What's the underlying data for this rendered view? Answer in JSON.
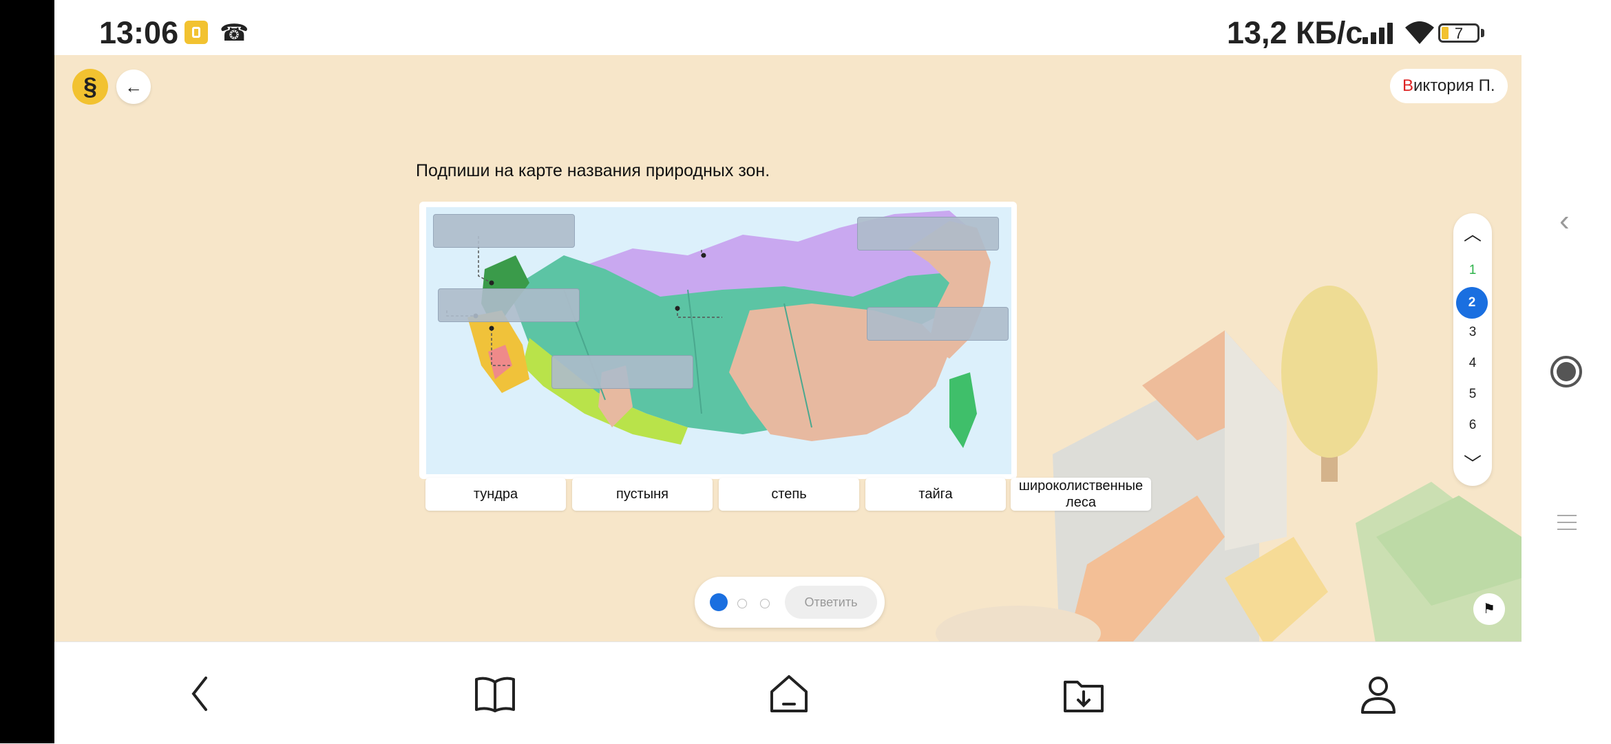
{
  "status_bar": {
    "time": "13:06",
    "net_speed": "13,2 КБ/с",
    "battery_level": "7",
    "icons": [
      "app-notification-icon",
      "missed-call-icon",
      "signal-icon",
      "wifi-icon",
      "battery-icon"
    ]
  },
  "header": {
    "logo_text": "§",
    "back_icon": "arrow-left-icon",
    "back_glyph": "←",
    "user_first_letter": "В",
    "user_rest": "иктория П."
  },
  "task": {
    "question": "Подпиши на карте названия природных зон.",
    "map_icon": "russia-natural-zones-map",
    "answer_options": [
      "тундра",
      "пустыня",
      "степь",
      "тайга",
      "широколиственные леса"
    ]
  },
  "pager": {
    "dots": [
      "active",
      "inactive",
      "inactive"
    ],
    "submit_label": "Ответить",
    "active_color": "#1a6fe0"
  },
  "question_nav": {
    "up_glyph": "︿",
    "down_glyph": "﹀",
    "numbers": [
      "1",
      "2",
      "3",
      "4",
      "5",
      "6"
    ],
    "completed": "1",
    "current": "2",
    "flag_glyph": "⚑"
  },
  "colors": {
    "background": "#f7e6c9",
    "accent_blue": "#1a6fe0",
    "brand_yellow": "#f2c230",
    "done_green": "#2db34a"
  },
  "bottom_nav": {
    "items": [
      "back-icon",
      "book-icon",
      "home-icon",
      "downloads-icon",
      "profile-icon"
    ]
  },
  "side_controls": [
    "chevron-left-icon",
    "record-icon",
    "menu-icon"
  ]
}
